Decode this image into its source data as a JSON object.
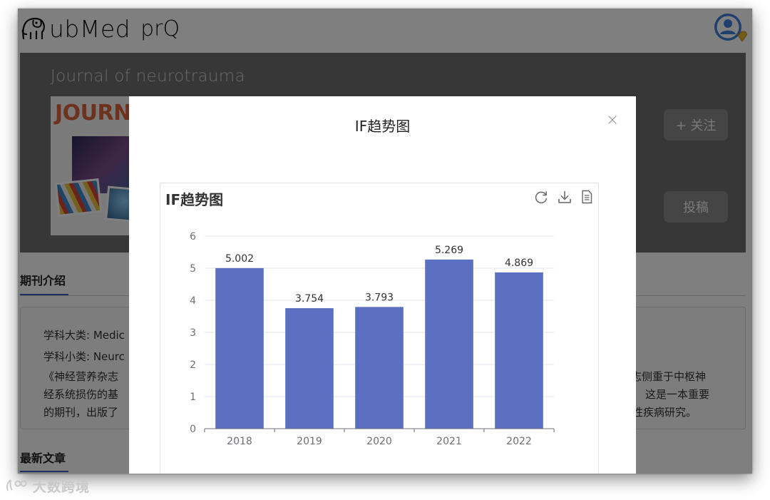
{
  "app": {
    "logo_text": "ubMed",
    "logo_pro": "prQ"
  },
  "journal": {
    "title": "Journal of neurotrauma",
    "cover_word": "JOURN",
    "follow_label": "+ 关注",
    "submit_label": "投稿"
  },
  "tabs": {
    "intro": "期刊介绍",
    "latest": "最新文章"
  },
  "intro": {
    "category_major": "学科大类: Medic",
    "category_minor": "学科小类: Neurc",
    "desc_left": [
      "《神经营养杂志",
      "经系统损伤的基",
      "的期刊，出版了"
    ],
    "desc_right": [
      "志侧重于中枢神",
      "这是一本重要",
      "性疾病研究。"
    ]
  },
  "modal": {
    "title": "IF趋势图",
    "close_symbol": "×"
  },
  "toolbox": {
    "refresh_icon": "refresh-icon",
    "download_icon": "download-icon",
    "data_view_icon": "data-view-icon"
  },
  "chart_data": {
    "type": "bar",
    "title": "IF趋势图",
    "categories": [
      "2018",
      "2019",
      "2020",
      "2021",
      "2022"
    ],
    "values": [
      5.002,
      3.754,
      3.793,
      5.269,
      4.869
    ],
    "value_labels": [
      "5.002",
      "3.754",
      "3.793",
      "5.269",
      "4.869"
    ],
    "ylim": [
      0,
      6
    ],
    "yticks": [
      "0",
      "1",
      "2",
      "3",
      "4",
      "5",
      "6"
    ],
    "grid": true,
    "bar_color": "#5b70c0",
    "xlabel": "",
    "ylabel": ""
  },
  "watermark": {
    "text": "大数跨境"
  }
}
